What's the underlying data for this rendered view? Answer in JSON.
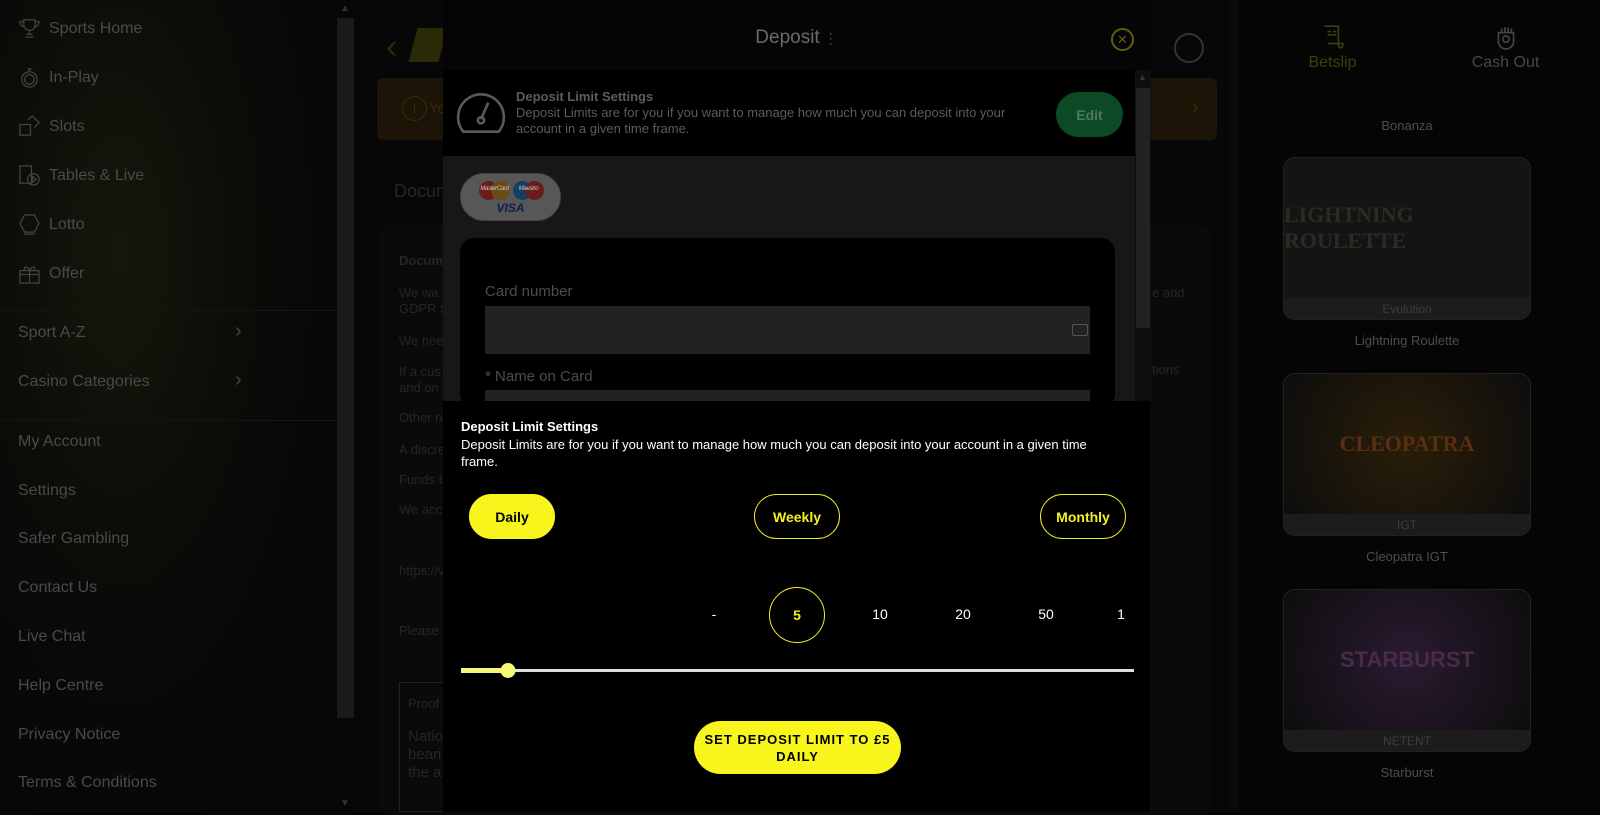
{
  "sidebar": {
    "items": [
      {
        "label": "Sports Home",
        "icon": "trophy-icon"
      },
      {
        "label": "In-Play",
        "icon": "stopwatch-icon"
      },
      {
        "label": "Slots",
        "icon": "dice-icon"
      },
      {
        "label": "Tables & Live",
        "icon": "cards-play-icon"
      },
      {
        "label": "Lotto",
        "icon": "lotto-ball-icon"
      },
      {
        "label": "Offer",
        "icon": "gift-icon"
      }
    ],
    "expandables": [
      {
        "label": "Sport A-Z"
      },
      {
        "label": "Casino Categories"
      }
    ],
    "links": [
      "My Account",
      "Settings",
      "Safer Gambling",
      "Contact Us",
      "Live Chat",
      "Help Centre",
      "Privacy Notice",
      "Terms & Conditions"
    ]
  },
  "background": {
    "banner_text": "Yo",
    "section_title": "Docum",
    "fragments": [
      "Docum",
      "We wa",
      "GDPR t",
      "We nee",
      "If a cus",
      "and on",
      "Other re",
      "A discre",
      "Funds b",
      "We acc",
      "https://v",
      "Please",
      "Proof",
      "Natio",
      "beari",
      "the a"
    ],
    "right_fragments": [
      "e and",
      "tions"
    ]
  },
  "modal": {
    "title": "Deposit",
    "top": {
      "title": "Deposit Limit Settings",
      "text": "Deposit Limits are for you if you want to manage how much you can deposit into your account in a given time frame.",
      "edit_label": "Edit"
    },
    "card_logos": [
      "MasterCard",
      "Maestro",
      "VISA"
    ],
    "card_number_label": "Card number",
    "name_label": "* Name on Card"
  },
  "limit_panel": {
    "title": "Deposit Limit Settings",
    "text": "Deposit Limits are for you if you want to manage how much you can deposit into your account in a given time frame.",
    "periods": [
      {
        "label": "Daily",
        "selected": true
      },
      {
        "label": "Weekly",
        "selected": false
      },
      {
        "label": "Monthly",
        "selected": false
      }
    ],
    "amounts": [
      "-",
      "5",
      "10",
      "20",
      "50",
      "1"
    ],
    "selected_amount": "5",
    "slider_fraction": 0.07,
    "set_button": "SET DEPOSIT LIMIT TO £5 DAILY",
    "accent": "#f7f51c"
  },
  "right": {
    "tabs": [
      {
        "label": "Betslip",
        "icon": "betslip-icon"
      },
      {
        "label": "Cash Out",
        "icon": "cash-out-icon"
      }
    ],
    "games": [
      {
        "name": "Bonanza"
      },
      {
        "name": "Lightning Roulette",
        "provider": "Evolution",
        "art": "LIGHTNING ROULETTE"
      },
      {
        "name": "Cleopatra IGT",
        "provider": "IGT",
        "art": "CLEOPATRA"
      },
      {
        "name": "Starburst",
        "provider": "NETENT",
        "art": "STARBURST"
      }
    ]
  }
}
